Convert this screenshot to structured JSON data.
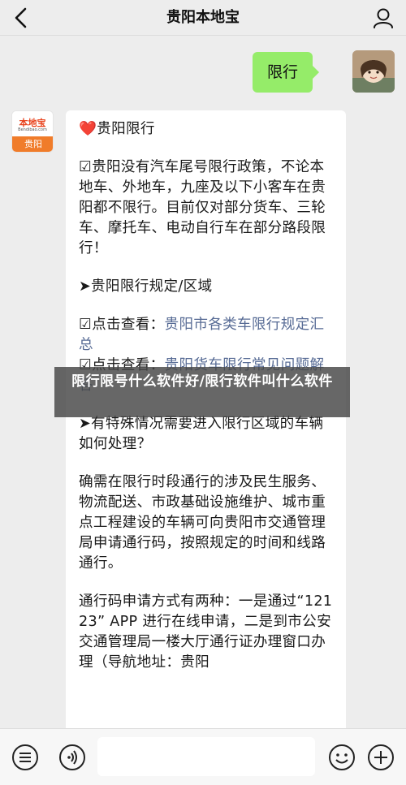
{
  "header": {
    "title": "贵阳本地宝"
  },
  "outgoing_message": {
    "text": "限行"
  },
  "bot": {
    "avatar_logo": "本地宝",
    "avatar_sub": "Bendibao.com",
    "avatar_city": "贵阳"
  },
  "reply": {
    "heading_icon": "❤️",
    "heading": "贵阳限行",
    "para1": "☑贵阳没有汽车尾号限行政策，不论本地车、外地车，九座及以下小客车在贵阳都不限行。目前仅对部分货车、三轮车、摩托车、电动自行车在部分路段限行！",
    "para2": "➤贵阳限行规定/区域",
    "link1_prefix": "☑点击查看：",
    "link1": "贵阳市各类车限行规定汇总",
    "link2_prefix": "☑点击查看：",
    "link2": "贵阳货车限行常见问题解答",
    "para3": "➤有特殊情况需要进入限行区域的车辆如何处理？",
    "para4": "确需在限行时段通行的涉及民生服务、物流配送、市政基础设施维护、城市重点工程建设的车辆可向贵阳市交通管理局申请通行码，按照规定的时间和线路通行。",
    "para5": "通行码申请方式有两种：一是通过“12123” APP 进行在线申请，二是到市公安交通管理局一楼大厅通行证办理窗口办理（导航地址：贵阳"
  },
  "overlay": {
    "text": "限行限号什么软件好/限行软件叫什么软件"
  },
  "bottom": {
    "input_placeholder": ""
  }
}
